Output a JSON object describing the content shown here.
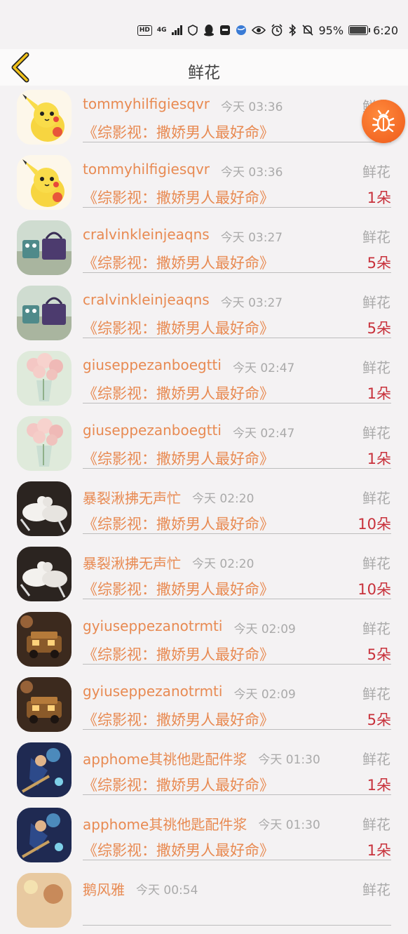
{
  "status_bar": {
    "network": "HD",
    "signal_type": "4G",
    "battery": "95%",
    "time": "6:20"
  },
  "header": {
    "title": "鲜花"
  },
  "rows": [
    {
      "user": "tommyhilfigiesqvr",
      "time": "今天 03:36",
      "label": "鲜花",
      "show": "《综影视：撒娇男人最好命》",
      "count": "",
      "avatar": "pikachu"
    },
    {
      "user": "tommyhilfigiesqvr",
      "time": "今天 03:36",
      "label": "鲜花",
      "show": "《综影视：撒娇男人最好命》",
      "count": "1朵",
      "avatar": "pikachu"
    },
    {
      "user": "cralvinkleinjeaqns",
      "time": "今天 03:27",
      "label": "鲜花",
      "show": "《综影视：撒娇男人最好命》",
      "count": "5朵",
      "avatar": "bag"
    },
    {
      "user": "cralvinkleinjeaqns",
      "time": "今天 03:27",
      "label": "鲜花",
      "show": "《综影视：撒娇男人最好命》",
      "count": "5朵",
      "avatar": "bag"
    },
    {
      "user": "giuseppezanboegtti",
      "time": "今天 02:47",
      "label": "鲜花",
      "show": "《综影视：撒娇男人最好命》",
      "count": "1朵",
      "avatar": "flowers"
    },
    {
      "user": "giuseppezanboegtti",
      "time": "今天 02:47",
      "label": "鲜花",
      "show": "《综影视：撒娇男人最好命》",
      "count": "1朵",
      "avatar": "flowers"
    },
    {
      "user": "暴裂湫拂无声忙",
      "time": "今天 02:20",
      "label": "鲜花",
      "show": "《综影视：撒娇男人最好命》",
      "count": "10朵",
      "avatar": "doves"
    },
    {
      "user": "暴裂湫拂无声忙",
      "time": "今天 02:20",
      "label": "鲜花",
      "show": "《综影视：撒娇男人最好命》",
      "count": "10朵",
      "avatar": "doves"
    },
    {
      "user": "gyiuseppezanotrmti",
      "time": "今天 02:09",
      "label": "鲜花",
      "show": "《综影视：撒娇男人最好命》",
      "count": "5朵",
      "avatar": "car"
    },
    {
      "user": "gyiuseppezanotrmti",
      "time": "今天 02:09",
      "label": "鲜花",
      "show": "《综影视：撒娇男人最好命》",
      "count": "5朵",
      "avatar": "car"
    },
    {
      "user": "apphome其祧他匙配件浆",
      "time": "今天 01:30",
      "label": "鲜花",
      "show": "《综影视：撒娇男人最好命》",
      "count": "1朵",
      "avatar": "game"
    },
    {
      "user": "apphome其祧他匙配件浆",
      "time": "今天 01:30",
      "label": "鲜花",
      "show": "《综影视：撒娇男人最好命》",
      "count": "1朵",
      "avatar": "game"
    },
    {
      "user": "鹅风雅",
      "time": "今天 00:54",
      "label": "鲜花",
      "show": "",
      "count": "",
      "avatar": "warm"
    }
  ],
  "colors": {
    "accent": "#e88a52",
    "count": "#c8313b",
    "muted": "#aaaaaa",
    "floating_button": "#f06a26"
  },
  "icons": {
    "back": "chevron-left-icon",
    "floating": "bug-icon"
  }
}
